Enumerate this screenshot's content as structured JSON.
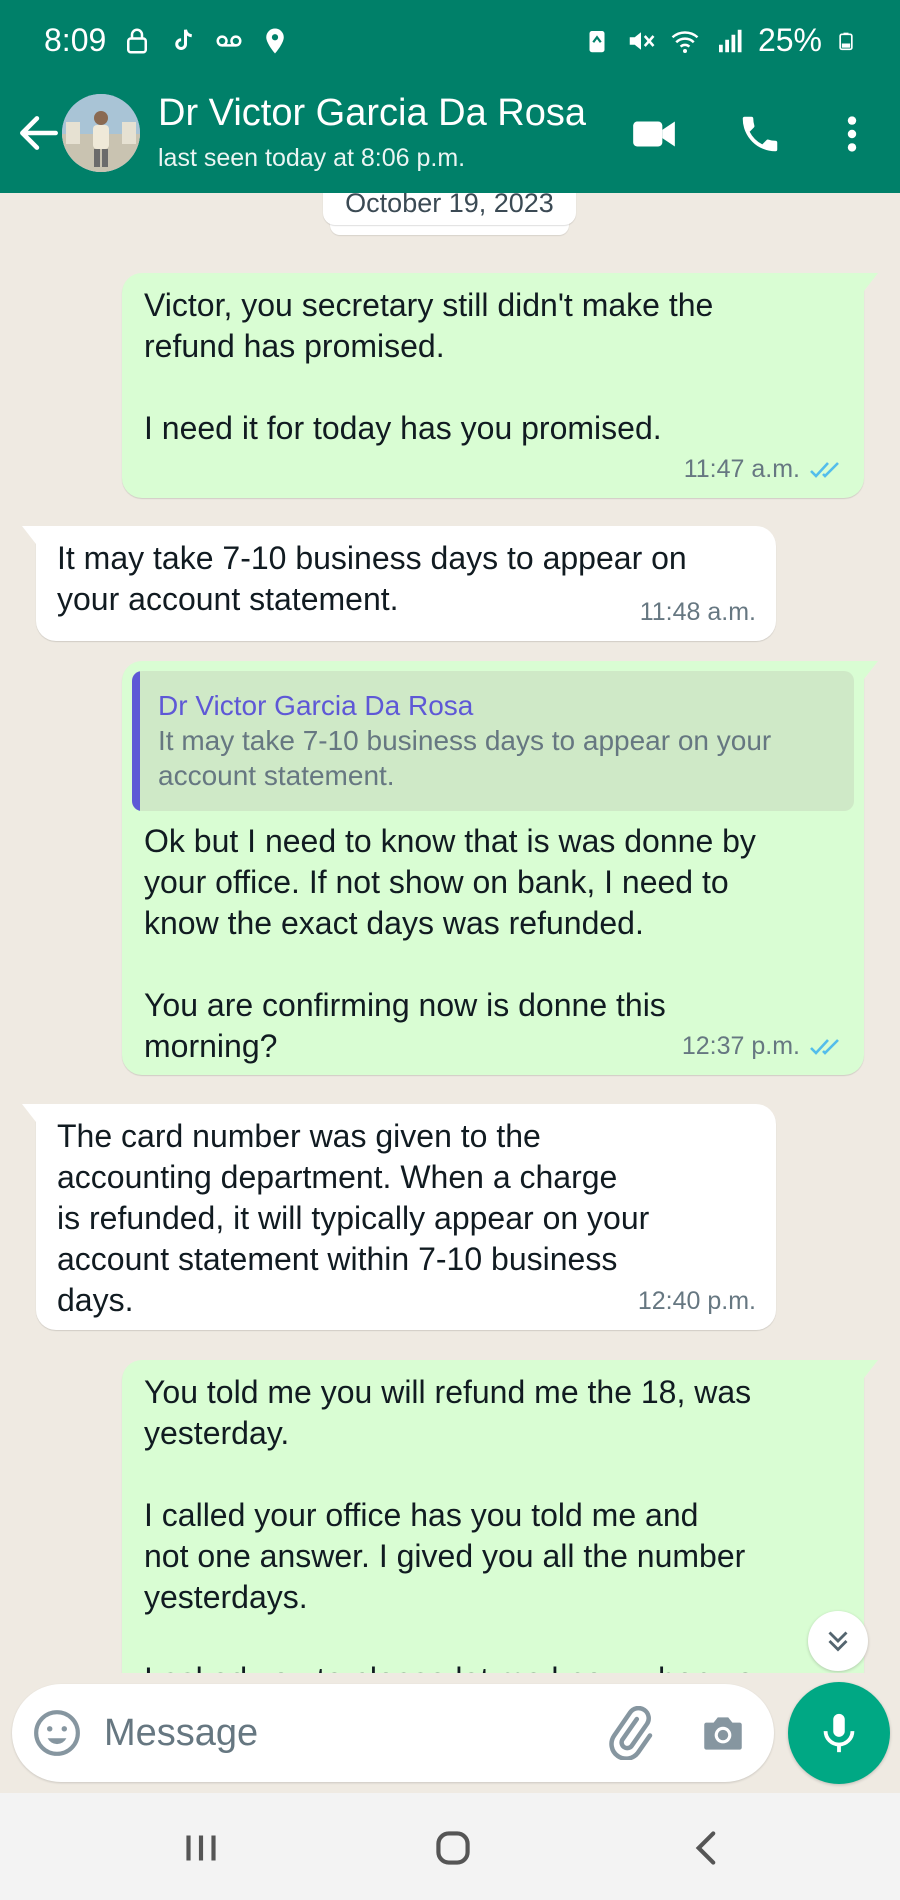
{
  "status_bar": {
    "time": "8:09",
    "battery": "25%"
  },
  "header": {
    "contact_name": "Dr Victor Garcia Da Rosa",
    "last_seen": "last seen today at 8:06 p.m."
  },
  "chat": {
    "date_chip": "October 19, 2023",
    "messages": [
      {
        "direction": "outgoing",
        "text": "Victor, you secretary still didn't make the\nrefund has promised.\n\nI need it for today has you promised.",
        "time": "11:47 a.m.",
        "status": "read"
      },
      {
        "direction": "incoming",
        "text": "It may take 7-10 business days to appear on\nyour account statement.",
        "time": "11:48 a.m."
      },
      {
        "direction": "outgoing",
        "quote": {
          "author": "Dr Victor Garcia Da Rosa",
          "text": "It may take 7-10 business days to appear on your\naccount statement."
        },
        "text": "Ok but I need to know that is was donne by\nyour office. If not show on bank, I need to\nknow the exact days was refunded.\n\nYou are confirming now is donne this\nmorning?",
        "time": "12:37 p.m.",
        "status": "read"
      },
      {
        "direction": "incoming",
        "text": "The card number was given to the\naccounting department. When a charge\nis refunded, it will typically appear on your\naccount statement within 7-10 business\ndays.",
        "time": "12:40 p.m."
      },
      {
        "direction": "outgoing",
        "text": "You told me you will refund me the 18, was\nyesterday.\n\nI called your office has you told me and\nnot one answer. I gived you all the number\nyesterdays.\n\nI asked you to please let me know when you",
        "time": "",
        "status": ""
      }
    ]
  },
  "composer": {
    "placeholder": "Message"
  },
  "colors": {
    "header": "#008069",
    "outgoing_bubble": "#d9fdd3",
    "incoming_bubble": "#ffffff",
    "chat_background": "#efeae2",
    "accent": "#00a884",
    "read_ticks": "#53bdeb",
    "quote_author": "#5e58d6"
  },
  "icons": {
    "status": [
      "lock-icon",
      "tiktok-icon",
      "voicemail-icon",
      "location-icon",
      "recycle-icon",
      "mute-icon",
      "wifi-icon",
      "signal-icon",
      "battery-icon"
    ],
    "header": [
      "back-arrow-icon",
      "video-call-icon",
      "phone-icon",
      "more-vert-icon"
    ],
    "composer": [
      "emoji-icon",
      "attach-icon",
      "camera-icon",
      "mic-icon"
    ],
    "navigation": [
      "recent-apps-icon",
      "home-icon",
      "back-icon"
    ]
  }
}
